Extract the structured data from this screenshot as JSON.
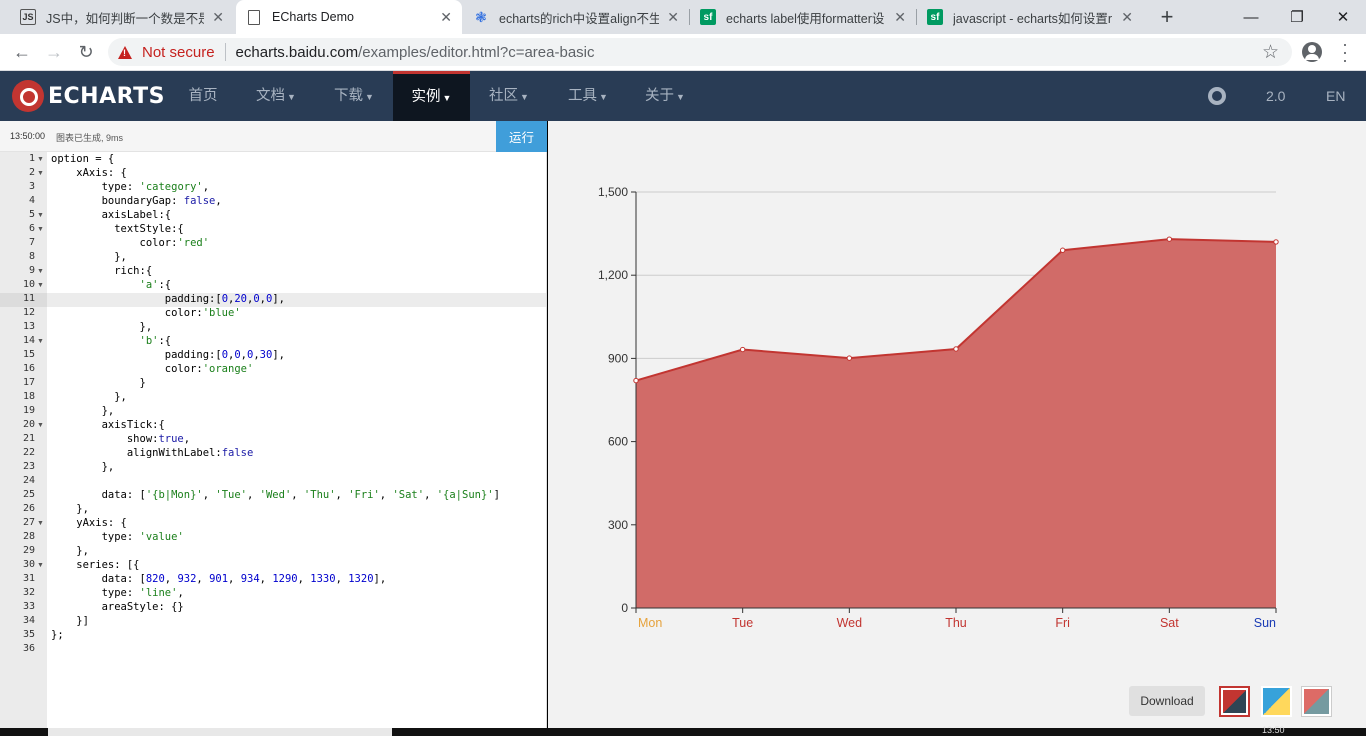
{
  "browser": {
    "tabs": [
      {
        "title": "JS中，如何判断一个数是不是小",
        "icon": "js-icon",
        "active": false
      },
      {
        "title": "ECharts Demo",
        "icon": "page-icon",
        "active": true
      },
      {
        "title": "echarts的rich中设置align不生",
        "icon": "baidu-paw-icon",
        "active": false
      },
      {
        "title": "echarts label使用formatter设",
        "icon": "sf-icon",
        "active": false
      },
      {
        "title": "javascript - echarts如何设置r",
        "icon": "sf-icon",
        "active": false
      }
    ],
    "new_tab": "+",
    "address": {
      "security": "Not secure",
      "host": "echarts.baidu.com",
      "path": "/examples/editor.html?c=area-basic"
    }
  },
  "nav": {
    "logo": "ECHARTS",
    "items": [
      {
        "label": "首页",
        "caret": false
      },
      {
        "label": "文档",
        "caret": true
      },
      {
        "label": "下载",
        "caret": true
      },
      {
        "label": "实例",
        "caret": true,
        "active": true
      },
      {
        "label": "社区",
        "caret": true
      },
      {
        "label": "工具",
        "caret": true
      },
      {
        "label": "关于",
        "caret": true
      }
    ],
    "version": "2.0",
    "language": "EN"
  },
  "editor": {
    "status_time": "13:50:00",
    "status_message": "图表已生成, 9ms",
    "run_label": "运行",
    "highlighted_line": 11,
    "lines": [
      "option = {",
      "    xAxis: {",
      "        type: 'category',",
      "        boundaryGap: false,",
      "        axisLabel:{",
      "          textStyle:{",
      "              color:'red'",
      "          },",
      "          rich:{",
      "              'a':{",
      "                  padding:[0,20,0,0],",
      "                  color:'blue'",
      "              },",
      "              'b':{",
      "                  padding:[0,0,0,30],",
      "                  color:'orange'",
      "              }",
      "          },",
      "        },",
      "        axisTick:{",
      "            show:true,",
      "            alignWithLabel:false",
      "        },",
      "",
      "        data: ['{b|Mon}', 'Tue', 'Wed', 'Thu', 'Fri', 'Sat', '{a|Sun}']",
      "    },",
      "    yAxis: {",
      "        type: 'value'",
      "    },",
      "    series: [{",
      "        data: [820, 932, 901, 934, 1290, 1330, 1320],",
      "        type: 'line',",
      "        areaStyle: {}",
      "    }]",
      "};",
      ""
    ],
    "folds": [
      1,
      2,
      5,
      6,
      9,
      10,
      14,
      20,
      27,
      30
    ]
  },
  "chart_data": {
    "type": "area",
    "categories": [
      "Mon",
      "Tue",
      "Wed",
      "Thu",
      "Fri",
      "Sat",
      "Sun"
    ],
    "category_colors": [
      "#e6a23c",
      "#c23531",
      "#c23531",
      "#c23531",
      "#c23531",
      "#c23531",
      "#1a3bb5"
    ],
    "series": [
      {
        "values": [
          820,
          932,
          901,
          934,
          1290,
          1330,
          1320
        ]
      }
    ],
    "yticks": [
      "0",
      "300",
      "600",
      "900",
      "1,200",
      "1,500"
    ],
    "ylim": [
      0,
      1500
    ],
    "grid": true,
    "colors": {
      "area": "#d16b68",
      "line": "#c23531"
    }
  },
  "chart_panel": {
    "download_label": "Download",
    "themes": [
      "default-theme",
      "light-theme",
      "dark-theme"
    ]
  },
  "taskbar": {
    "clock": "13:50"
  }
}
